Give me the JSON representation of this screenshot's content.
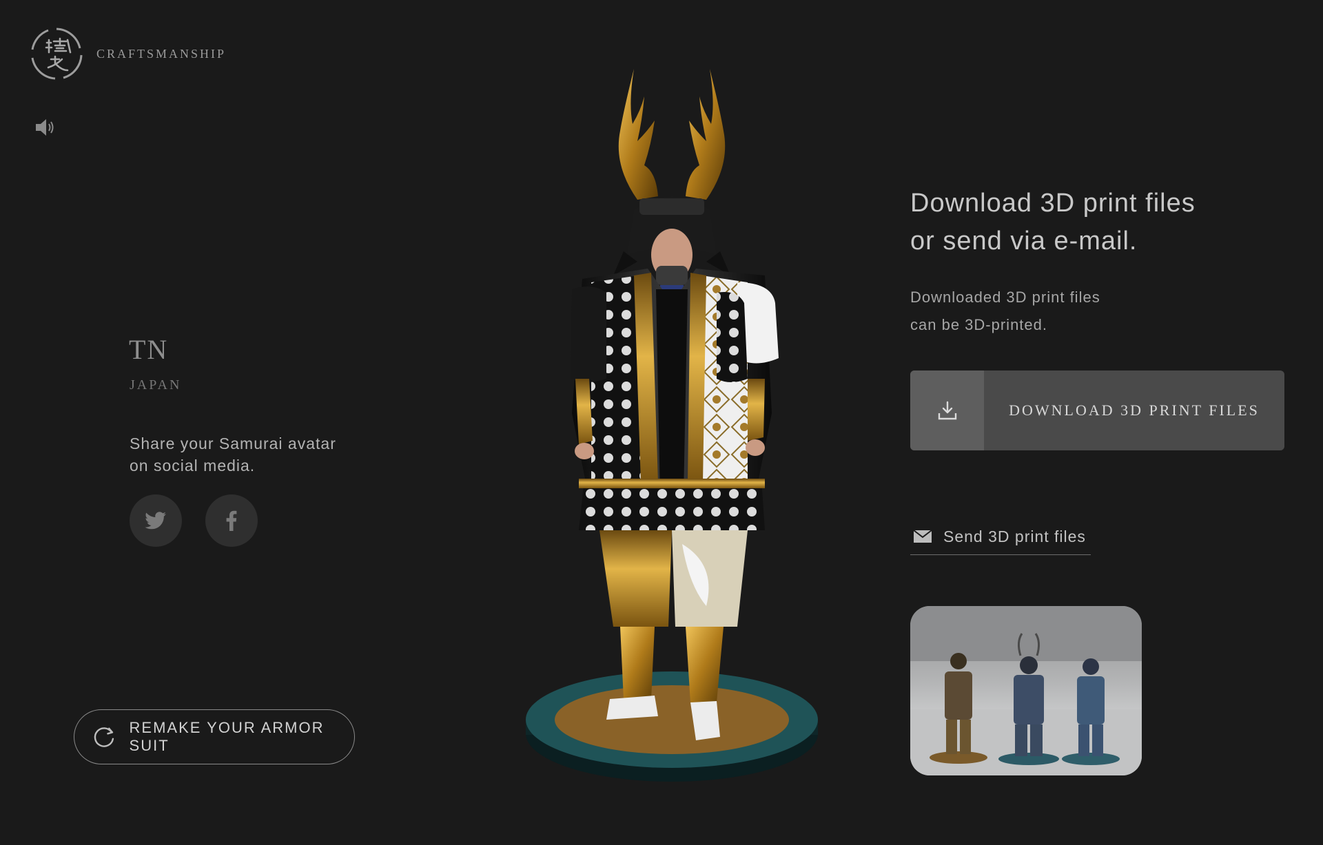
{
  "brand": {
    "name": "CRAFTSMANSHIP",
    "logo_icon": "kanji-seal-logo-icon"
  },
  "sound": {
    "icon": "speaker-icon"
  },
  "user": {
    "name": "TN",
    "country": "JAPAN"
  },
  "share": {
    "line1": "Share your Samurai avatar",
    "line2": "on social media.",
    "twitter_icon": "twitter-icon",
    "facebook_icon": "facebook-icon"
  },
  "remake": {
    "label": "REMAKE YOUR ARMOR SUIT",
    "icon": "refresh-icon"
  },
  "download": {
    "heading_line1": "Download 3D print files",
    "heading_line2": "or send via e-mail.",
    "sub_line1": "Downloaded 3D print files",
    "sub_line2": "can be 3D-printed.",
    "button_label": "DOWNLOAD 3D PRINT FILES",
    "button_icon": "download-icon"
  },
  "send": {
    "label": "Send 3D print files",
    "icon": "envelope-icon"
  },
  "colors": {
    "background": "#1a1a1a",
    "button_dark": "#4a4a4a",
    "button_icon_box": "#5e5e5e",
    "gold": "#c8962a",
    "teal_base": "#1e4f52"
  }
}
